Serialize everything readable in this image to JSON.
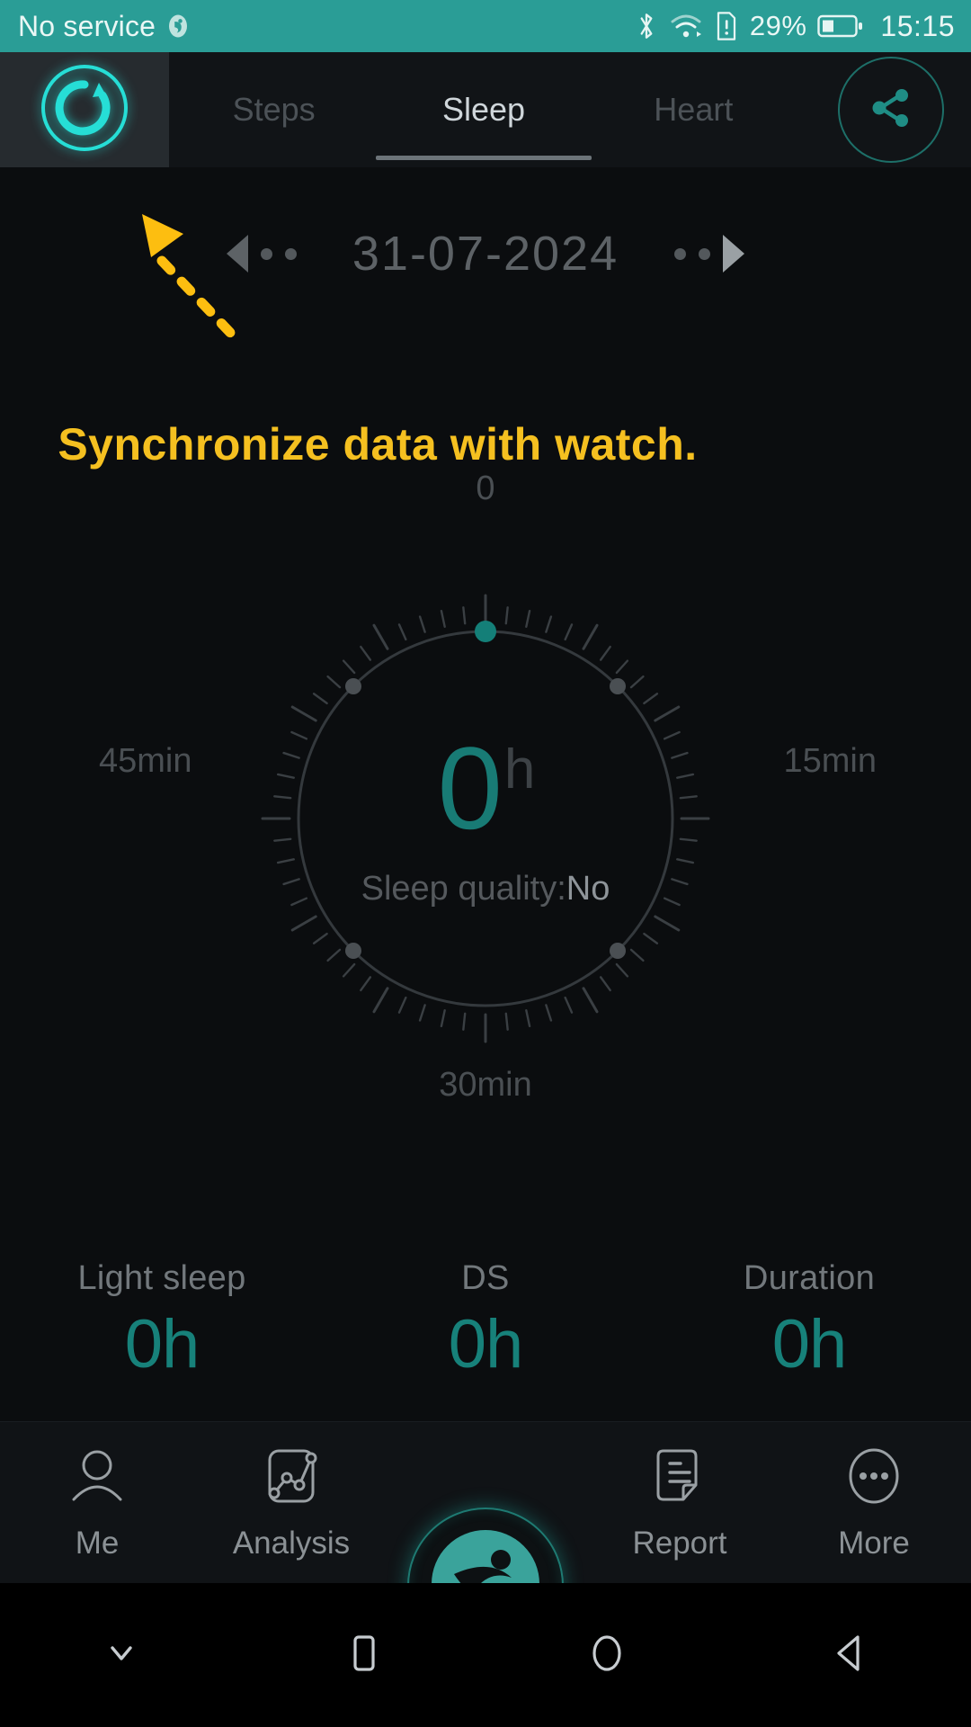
{
  "status_bar": {
    "carrier": "No service",
    "carrier_icon": "carrier-badge-icon",
    "bluetooth_icon": "bluetooth-icon",
    "wifi_icon": "wifi-icon",
    "sim_alert_icon": "sim-alert-icon",
    "battery_percent": "29%",
    "battery_icon": "battery-icon",
    "time": "15:15",
    "background_color": "#2a9d96"
  },
  "top_bar": {
    "sync_icon": "sync-refresh-icon",
    "share_icon": "share-icon",
    "tabs": [
      {
        "label": "Steps",
        "active": false
      },
      {
        "label": "Sleep",
        "active": true
      },
      {
        "label": "Heart",
        "active": false
      }
    ]
  },
  "date_selector": {
    "prev_icon": "arrow-left-icon",
    "next_icon": "arrow-right-icon",
    "date": "31-07-2024"
  },
  "annotation": {
    "text": "Synchronize data with watch.",
    "color": "#f5c020",
    "arrow_icon": "pointer-arrow-icon"
  },
  "sleep_dial": {
    "top_label": "0",
    "right_label": "15min",
    "bottom_label": "30min",
    "left_label": "45min",
    "value": "0",
    "unit": "h",
    "quality_label": "Sleep quality:",
    "quality_value": "No",
    "accent_color": "#17817a",
    "marker_color": "#147f78"
  },
  "stats": [
    {
      "label": "Light sleep",
      "value": "0h"
    },
    {
      "label": "DS",
      "value": "0h"
    },
    {
      "label": "Duration",
      "value": "0h"
    }
  ],
  "bottom_nav": {
    "items": [
      {
        "label": "Me",
        "icon": "person-icon"
      },
      {
        "label": "Analysis",
        "icon": "chart-icon"
      },
      {
        "label": "Report",
        "icon": "document-icon"
      },
      {
        "label": "More",
        "icon": "ellipsis-circle-icon"
      }
    ],
    "center_icon": "app-logo-icon"
  },
  "android_nav": {
    "buttons": [
      {
        "icon": "chevron-down-icon"
      },
      {
        "icon": "square-recents-icon"
      },
      {
        "icon": "circle-home-icon"
      },
      {
        "icon": "triangle-back-icon"
      }
    ]
  }
}
